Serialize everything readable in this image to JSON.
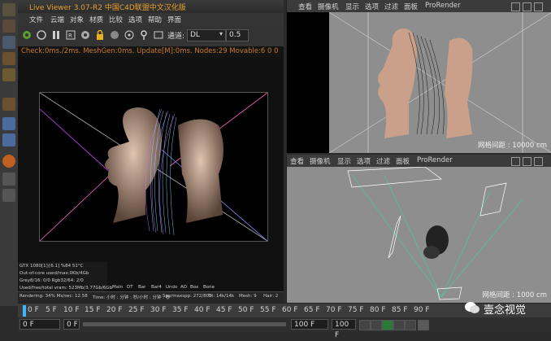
{
  "live_viewer": {
    "title": "Live Viewer 3.07-R2 中国C4D联盟中文汉化版",
    "menu": [
      "文件",
      "云端",
      "对象",
      "材质",
      "比较",
      "选项",
      "帮助",
      "界面"
    ],
    "channel_label": "通道:",
    "channel_value": "DL",
    "exposure_value": "0.5",
    "status_line": "Check:0ms./2ms. MeshGen:0ms. Update[M]:0ms. Nodes:29 Movable:6  0 0",
    "stats": [
      "GTX 1080[1]{6.1]        %84    51°C",
      "Out-of-core used/max:0Kb/4Gb",
      "Grey8/16: 0/0            Rgb32/64: 2/0",
      "Used/free/total vram: 523Mb/3.77Gb/6Gb"
    ],
    "bottom_tabs": [
      "Main",
      "DT",
      "Bar",
      "Bar4",
      "Undo",
      "AO",
      "Box",
      "Bone"
    ],
    "bottom_status": {
      "rendering": "Rendering: 34%  Ms/sec: 12.58",
      "time": "Time: 小时 : 分钟 : 秒/小时 : 分钟 : 秒",
      "spp": "Spp/maxspp: 272/800",
      "tri": "Tri: 14k/14k",
      "mesh": "Mesh: 9",
      "hair": "Hair: 2"
    }
  },
  "viewport_top": {
    "menu": [
      "查看",
      "摄像机",
      "显示",
      "选项",
      "过滤",
      "面板",
      "ProRender"
    ],
    "grid_spacing": "网格间距 : 10000 cm"
  },
  "viewport_bottom": {
    "menu": [
      "查看",
      "摄像机",
      "显示",
      "选项",
      "过滤",
      "面板",
      "ProRender"
    ],
    "grid_spacing": "网格间距 : 1000 cm"
  },
  "timeline": {
    "ticks": [
      "0 F",
      "5 F",
      "10 F",
      "15 F",
      "20 F",
      "25 F",
      "30 F",
      "35 F",
      "40 F",
      "45 F",
      "50 F",
      "55 F",
      "60 F",
      "65 F",
      "70 F",
      "75 F",
      "80 F",
      "85 F",
      "90 F"
    ],
    "start_field": "0 F",
    "current_field": "0 F",
    "end_field": "100 F",
    "end_field2": "100 F"
  },
  "watermark": {
    "text": "壹念视觉"
  },
  "colors": {
    "accent_orange": "#e8a030",
    "status_orange": "#c87a2a",
    "viewport_grey": "#8e8e8e"
  }
}
